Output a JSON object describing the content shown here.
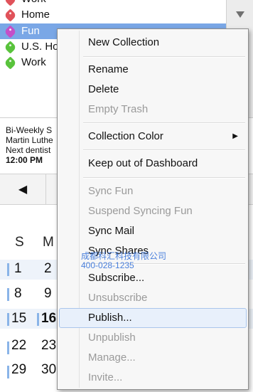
{
  "collections": [
    {
      "label": "Work",
      "color": "#e0525a"
    },
    {
      "label": "Home",
      "color": "#e0525a"
    },
    {
      "label": "Fun",
      "color": "#c44fc8",
      "selected": true
    },
    {
      "label": "U.S. Ho",
      "color": "#59c33c"
    },
    {
      "label": "Work",
      "color": "#59c33c"
    }
  ],
  "scrollbar": {
    "down_icon": "chevron-down-icon"
  },
  "events": {
    "line1": "Bi-Weekly S",
    "line2": "Martin Luthe",
    "line3": "Next dentist",
    "time": "12:00 PM"
  },
  "nav": {
    "prev_icon": "◀"
  },
  "calendar": {
    "dow": [
      "S",
      "M"
    ],
    "weeks": [
      [
        "1",
        "2"
      ],
      [
        "8",
        "9"
      ],
      [
        "15",
        "16"
      ],
      [
        "22",
        "23"
      ],
      [
        "29",
        "30"
      ]
    ],
    "today": "16"
  },
  "menu": {
    "new_collection": "New Collection",
    "rename": "Rename",
    "delete": "Delete",
    "empty_trash": "Empty Trash",
    "collection_color": "Collection Color",
    "submenu_arrow": "▶",
    "keep_out": "Keep out of Dashboard",
    "sync_fun": "Sync Fun",
    "suspend_sync": "Suspend Syncing Fun",
    "sync_mail": "Sync Mail",
    "sync_shares": "Sync Shares",
    "subscribe": "Subscribe...",
    "unsubscribe": "Unsubscribe",
    "publish": "Publish...",
    "unpublish": "Unpublish",
    "manage": "Manage...",
    "invite": "Invite..."
  },
  "watermark": {
    "line1": "成都科汇科技有限公司",
    "line2": "400-028-1235"
  },
  "colors": {
    "selection": "#7aa7e6",
    "accent_bar": "#8ab4e8",
    "menu_highlight": "#e8f0fb"
  }
}
